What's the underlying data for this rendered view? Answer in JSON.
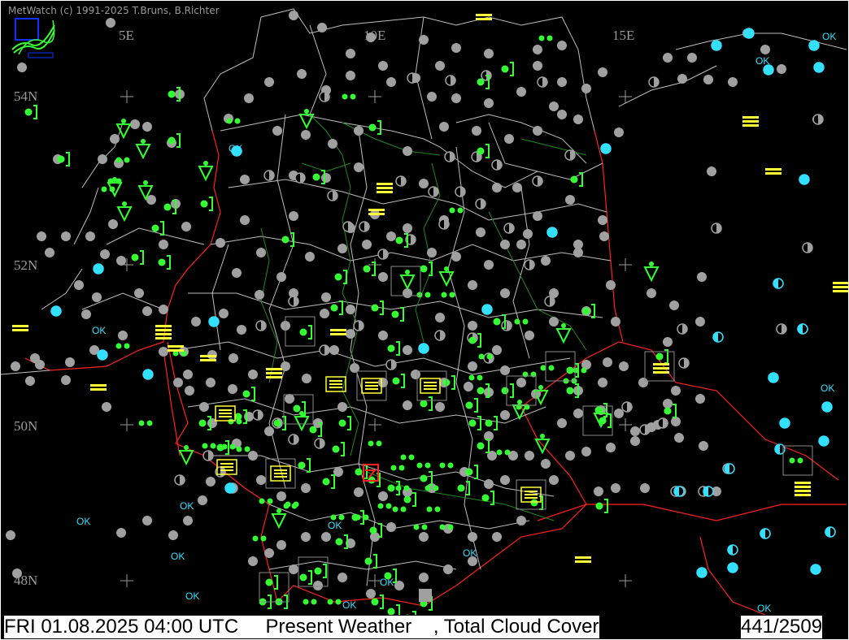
{
  "app": {
    "credit": "MetWatch  (c) 1991-2025 T.Bruns, B.Richter"
  },
  "map": {
    "longitude_labels": [
      "5E",
      "10E",
      "15E"
    ],
    "latitude_labels": [
      "54N",
      "52N",
      "50N",
      "48N"
    ],
    "cloud_cover_label": "OK"
  },
  "status": {
    "datetime": "FRI 01.08.2025 04:00 UTC",
    "layers": "Present Weather    , Total Cloud Cover",
    "station_count": "441/2509"
  },
  "colors": {
    "background": "#000000",
    "borders": "#ff0000",
    "regions": "#c8c8c8",
    "rivers": "#1f8a1f",
    "rain": "#33ff33",
    "fog": "#ffff33",
    "clear_sky": "#33e0ff",
    "overcast": "#a0a0a0",
    "grid": "#9a9a9a"
  }
}
